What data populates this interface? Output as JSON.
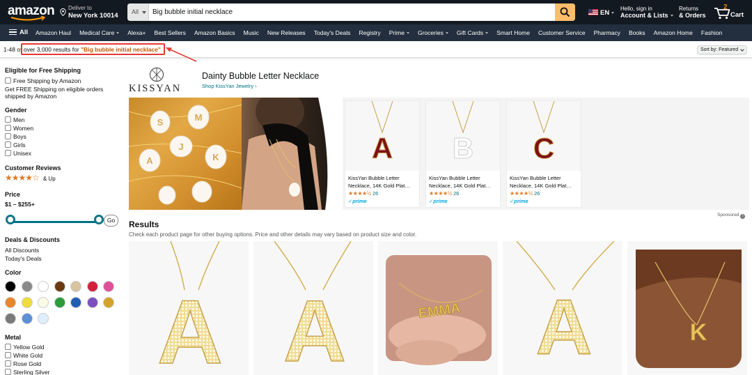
{
  "header": {
    "logo": "amazon",
    "deliver_line1": "Deliver to",
    "deliver_line2": "New York 10014",
    "search_category": "All",
    "search_value": "Big bubble initial necklace",
    "language": "EN",
    "account_line1": "Hello, sign in",
    "account_line2": "Account & Lists",
    "orders_line1": "Returns",
    "orders_line2": "& Orders",
    "cart_count": "2",
    "cart_label": "Cart",
    "brand_color": "#131921",
    "search_button_color": "#febd69"
  },
  "nav": {
    "all_label": "All",
    "links": [
      "Amazon Haul",
      "Medical Care",
      "Alexa+",
      "Best Sellers",
      "Amazon Basics",
      "Music",
      "New Releases",
      "Today's Deals",
      "Registry",
      "Prime",
      "Groceries",
      "Gift Cards",
      "Smart Home",
      "Customer Service",
      "Pharmacy",
      "Books",
      "Amazon Home",
      "Fashion"
    ]
  },
  "results": {
    "range": "1-48 of",
    "count_text": "over 3,000 results for",
    "query": "\"Big bubble initial necklace\"",
    "sort_label": "Sort by:",
    "sort_value": "Featured"
  },
  "sidebar": {
    "shipping_heading": "Eligible for Free Shipping",
    "shipping_option": "Free Shipping by Amazon",
    "shipping_note_1": "Get FREE Shipping on eligible orders",
    "shipping_note_2": "shipped by Amazon",
    "gender_heading": "Gender",
    "gender_options": [
      "Men",
      "Women",
      "Boys",
      "Girls",
      "Unisex"
    ],
    "reviews_heading": "Customer Reviews",
    "reviews_stars": "★★★★☆",
    "reviews_up": "& Up",
    "price_heading": "Price",
    "price_range": "$1 – $255+",
    "price_min_fraction": 0,
    "price_max_fraction": 1,
    "go_label": "Go",
    "deals_heading": "Deals & Discounts",
    "deals_options": [
      "All Discounts",
      "Today's Deals"
    ],
    "color_heading": "Color",
    "colors": [
      "#000000",
      "#8a8a8a",
      "#ffffff",
      "#6b3a12",
      "#d9c3a0",
      "#d1213b",
      "#e04f9a",
      "#e8862a",
      "#f0dc3a",
      "#fafbe6",
      "#2d9a3c",
      "#1e5fb4",
      "#7b4fc1",
      "#d4a32a",
      "#7a7a7a",
      "#5b8fd6",
      "#dfefff"
    ],
    "metal_heading": "Metal",
    "metal_options": [
      "Yellow Gold",
      "White Gold",
      "Rose Gold",
      "Sterling Silver"
    ]
  },
  "brand": {
    "name": "KISSYAN",
    "title": "Dainty Bubble Letter Necklace",
    "link": "Shop KissYan Jewelry ›",
    "products": [
      {
        "title": "KissYan Bubble Letter Necklace, 14K Gold Plat…",
        "rating": 4.5,
        "stars": "★★★★½",
        "reviews": "26",
        "prime": "✓prime",
        "letter": "A",
        "letter_color": "#7c1118"
      },
      {
        "title": "KissYan Bubble Letter Necklace, 14K Gold Plat…",
        "rating": 4.5,
        "stars": "★★★★½",
        "reviews": "26",
        "prime": "✓prime",
        "letter": "B",
        "letter_color": "#ffffff"
      },
      {
        "title": "KissYan Bubble Letter Necklace, 14K Gold Plat…",
        "rating": 4.5,
        "stars": "★★★★½",
        "reviews": "26",
        "prime": "✓prime",
        "letter": "C",
        "letter_color": "#7c1118"
      }
    ],
    "sponsored": "Sponsored"
  },
  "main": {
    "results_heading": "Results",
    "results_sub": "Check each product page for other buying options. Price and other details may vary based on product size and color.",
    "product_letters": [
      "A",
      "A",
      "EMMA",
      "A",
      "K"
    ]
  }
}
